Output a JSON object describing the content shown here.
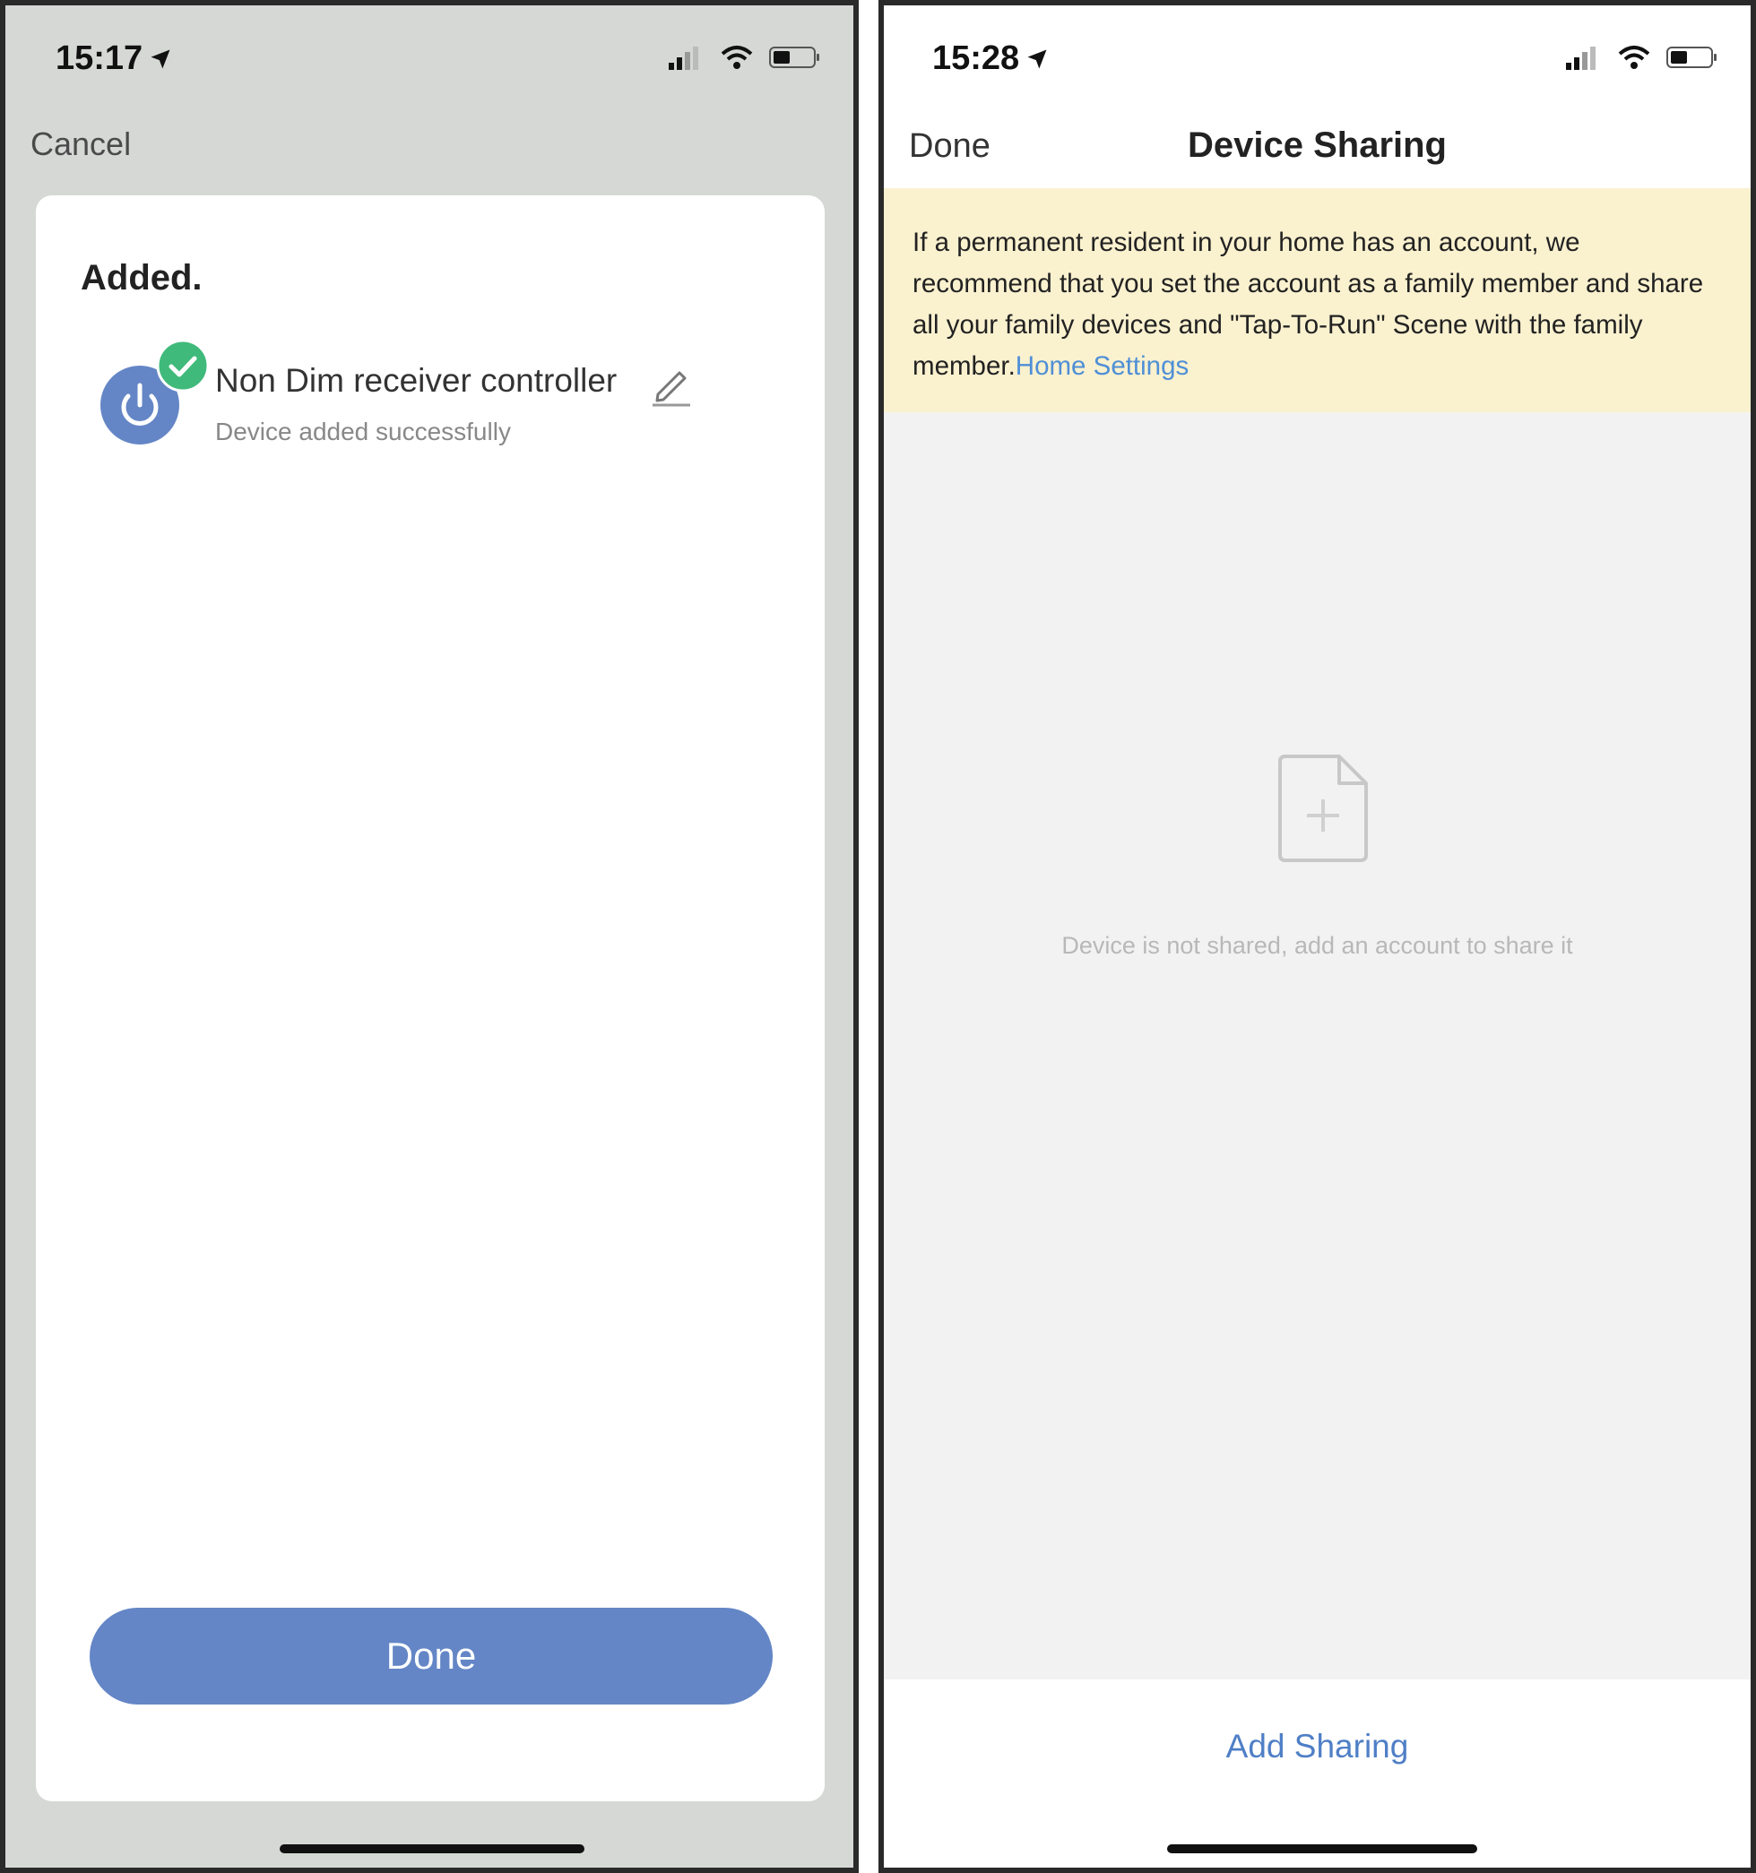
{
  "left_screen": {
    "status_time": "15:17",
    "cancel_label": "Cancel",
    "added_title": "Added.",
    "device": {
      "name": "Non Dim receiver controller",
      "status": "Device added successfully"
    },
    "done_label": "Done"
  },
  "right_screen": {
    "status_time": "15:28",
    "done_label": "Done",
    "title": "Device Sharing",
    "notice_text": "If a permanent resident in your home has an account, we recommend that you set the account as a family member and share all your family devices and \"Tap-To-Run\" Scene with the family member.",
    "notice_link": "Home Settings",
    "empty_message": "Device is not shared, add an account to share it",
    "add_sharing_label": "Add Sharing"
  },
  "colors": {
    "accent_blue": "#6486c6",
    "success_green": "#3fba7a",
    "link_blue": "#4f8fd6",
    "notice_bg": "#faf1cf"
  }
}
